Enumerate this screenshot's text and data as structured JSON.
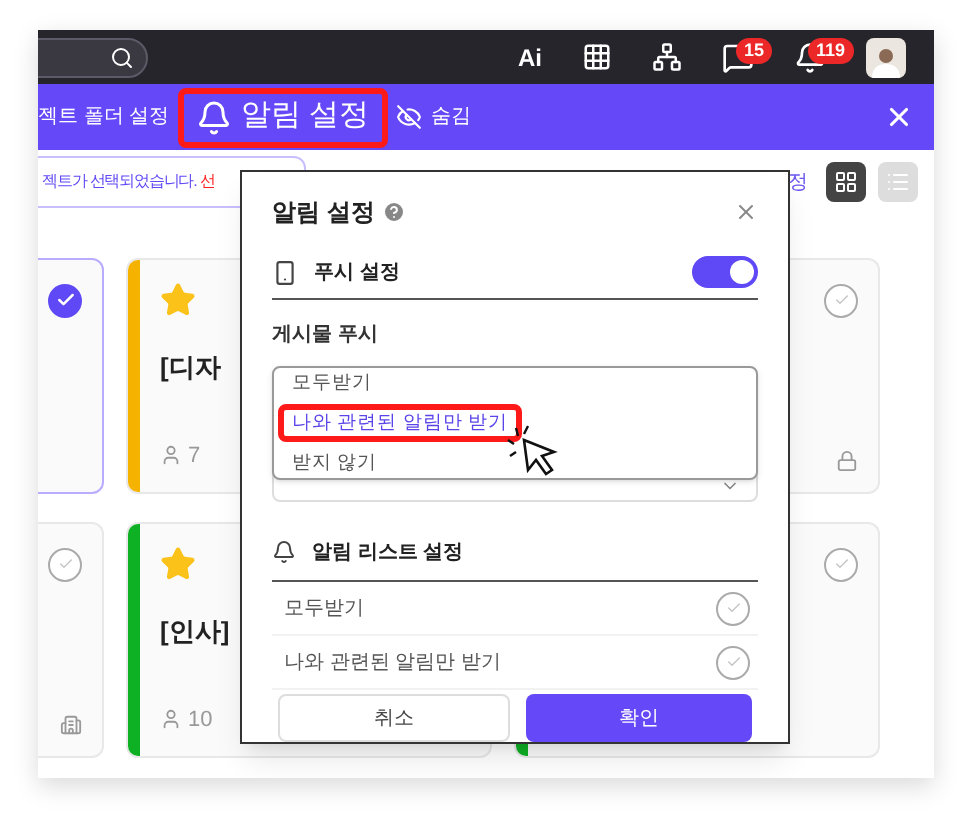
{
  "top_bar": {
    "ai_label": "Ai",
    "badges": [
      {
        "kind": "chat",
        "count": "15"
      },
      {
        "kind": "bell",
        "count": "119"
      }
    ]
  },
  "toolbar": {
    "items": [
      {
        "kind": "text",
        "label": "젝트 폴더 설정",
        "selected": false,
        "highlighted": false
      },
      {
        "kind": "bell",
        "label": "알림 설정",
        "selected": true,
        "highlighted": true
      },
      {
        "kind": "eye",
        "label": "숨김",
        "selected": false,
        "highlighted": false
      }
    ]
  },
  "notice": {
    "text": "젝트가 선택되었습니다. ",
    "emphasis": "선"
  },
  "side_link": "정",
  "view_toggle": [
    {
      "kind": "grid",
      "selected": true
    },
    {
      "kind": "list",
      "selected": false
    }
  ],
  "cards": [
    {
      "kind": "plain",
      "checked": true
    },
    {
      "kind": "plain",
      "color": "#f5b300",
      "title": "[디자",
      "members": "7",
      "starred": true
    },
    {
      "kind": "lock",
      "checked": false
    },
    {
      "kind": "building",
      "checked": false
    },
    {
      "kind": "plain",
      "color": "#0eb024",
      "title": "[인사]",
      "members": "10",
      "starred": true
    },
    {
      "kind": "plain",
      "color": "#0eb024",
      "checked": false
    }
  ],
  "dialog": {
    "title": "알림 설정",
    "push": {
      "label": "푸시 설정",
      "on": true
    },
    "post_push": {
      "label": "게시물 푸시",
      "options": [
        {
          "label": "모두받기",
          "selected": false,
          "highlighted": false
        },
        {
          "label": "나와 관련된 알림만 받기",
          "selected": true,
          "highlighted": true
        },
        {
          "label": "받지 않기",
          "selected": false,
          "highlighted": false
        }
      ]
    },
    "list_settings": {
      "label": "알림 리스트 설정",
      "rows": [
        {
          "label": "모두받기",
          "checked": false
        },
        {
          "label": "나와 관련된 알림만 받기",
          "checked": false
        }
      ]
    },
    "buttons": [
      {
        "kind": "secondary",
        "label": "취소"
      },
      {
        "kind": "primary",
        "label": "확인"
      }
    ]
  }
}
